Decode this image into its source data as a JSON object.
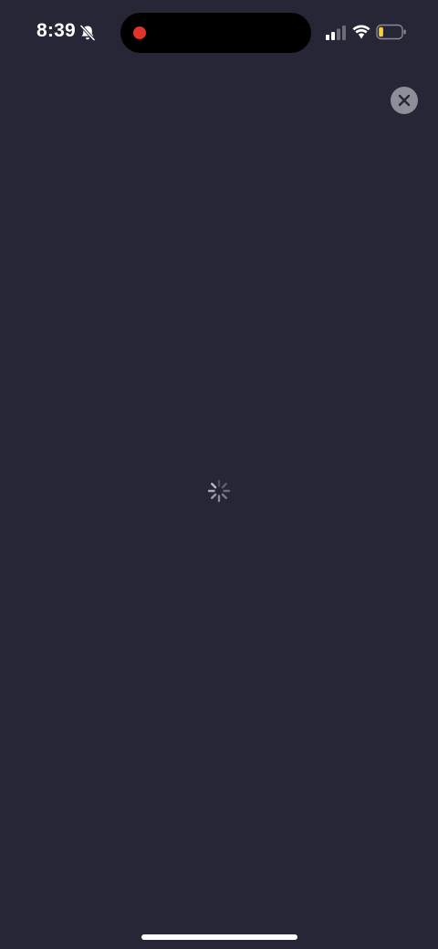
{
  "status_bar": {
    "time": "8:39",
    "silent_icon": "bell-slash-icon",
    "recording_indicator_color": "#e0342a",
    "signal_icon": "cellular-signal-icon",
    "signal_bars_active": 2,
    "signal_bars_total": 4,
    "wifi_icon": "wifi-icon",
    "battery_icon": "battery-icon",
    "battery_level": 0.2,
    "battery_color": "#f5d130"
  },
  "screen": {
    "background_color": "#262637",
    "close_button_icon": "close-icon",
    "loading_indicator": "activity-spinner-icon"
  }
}
